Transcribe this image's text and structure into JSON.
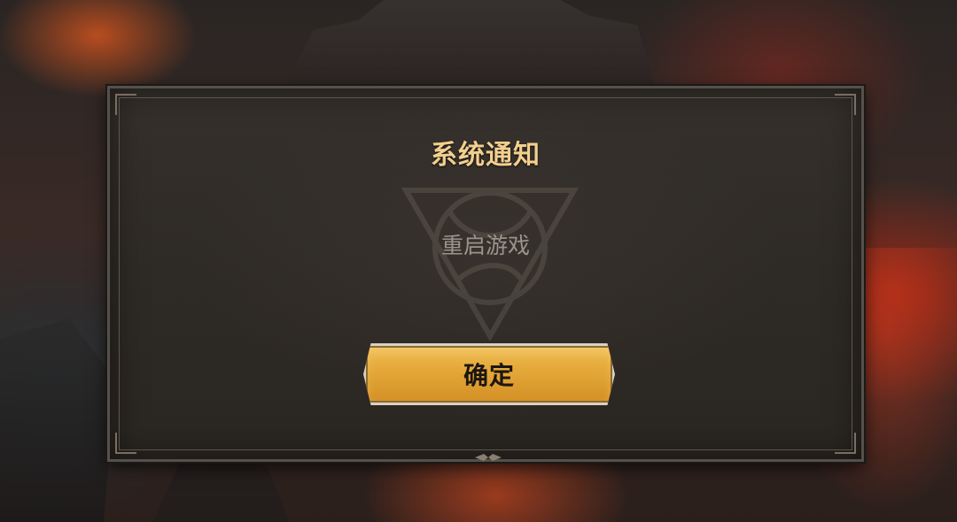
{
  "dialog": {
    "title": "系统通知",
    "message": "重启游戏",
    "confirm_label": "确定"
  },
  "colors": {
    "title": "#f3cf8e",
    "message": "#9a948c",
    "button": "#e5a93a",
    "panel": "#2e2a26"
  },
  "icons": {
    "emblem": "faction-emblem-icon",
    "ornament": "ornament-icon"
  }
}
